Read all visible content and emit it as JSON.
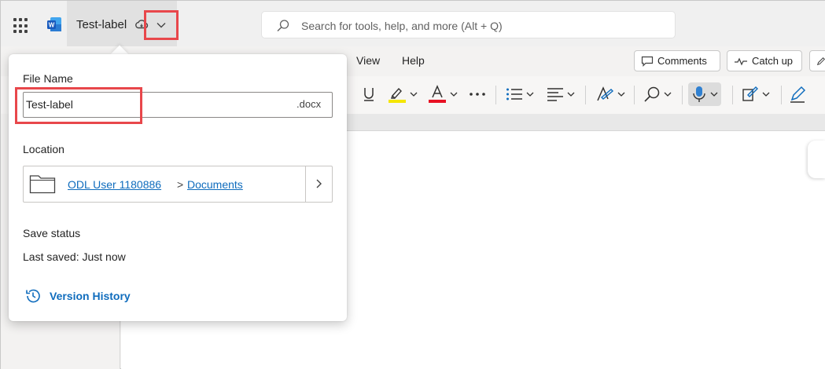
{
  "header": {
    "doc_title": "Test-label",
    "search_placeholder": "Search for tools, help, and more (Alt + Q)"
  },
  "menu": {
    "items": [
      "View",
      "Help"
    ],
    "comments_label": "Comments",
    "catchup_label": "Catch up"
  },
  "panel": {
    "file_name_label": "File Name",
    "file_name_value": "Test-label",
    "extension": ".docx",
    "location_label": "Location",
    "location_parts": [
      "ODL User 1180886",
      "Documents"
    ],
    "location_separator": ">",
    "save_status_label": "Save status",
    "last_saved": "Last saved: Just now",
    "version_history_label": "Version History"
  },
  "colors": {
    "accent": "#0f6cbd",
    "highlight_box": "#e8474b",
    "word_blue": "#185abd",
    "highlighter_yellow": "#f5e600",
    "font_color_red": "#e81123"
  }
}
